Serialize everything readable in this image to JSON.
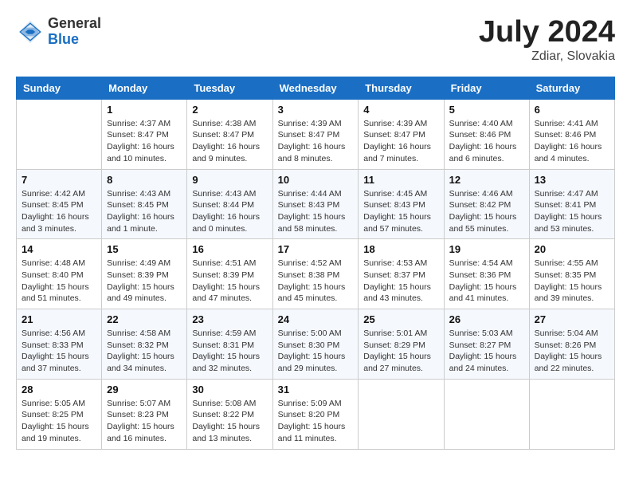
{
  "header": {
    "logo_line1": "General",
    "logo_line2": "Blue",
    "month": "July 2024",
    "location": "Zdiar, Slovakia"
  },
  "weekdays": [
    "Sunday",
    "Monday",
    "Tuesday",
    "Wednesday",
    "Thursday",
    "Friday",
    "Saturday"
  ],
  "weeks": [
    [
      {
        "day": "",
        "info": ""
      },
      {
        "day": "1",
        "info": "Sunrise: 4:37 AM\nSunset: 8:47 PM\nDaylight: 16 hours\nand 10 minutes."
      },
      {
        "day": "2",
        "info": "Sunrise: 4:38 AM\nSunset: 8:47 PM\nDaylight: 16 hours\nand 9 minutes."
      },
      {
        "day": "3",
        "info": "Sunrise: 4:39 AM\nSunset: 8:47 PM\nDaylight: 16 hours\nand 8 minutes."
      },
      {
        "day": "4",
        "info": "Sunrise: 4:39 AM\nSunset: 8:47 PM\nDaylight: 16 hours\nand 7 minutes."
      },
      {
        "day": "5",
        "info": "Sunrise: 4:40 AM\nSunset: 8:46 PM\nDaylight: 16 hours\nand 6 minutes."
      },
      {
        "day": "6",
        "info": "Sunrise: 4:41 AM\nSunset: 8:46 PM\nDaylight: 16 hours\nand 4 minutes."
      }
    ],
    [
      {
        "day": "7",
        "info": "Sunrise: 4:42 AM\nSunset: 8:45 PM\nDaylight: 16 hours\nand 3 minutes."
      },
      {
        "day": "8",
        "info": "Sunrise: 4:43 AM\nSunset: 8:45 PM\nDaylight: 16 hours\nand 1 minute."
      },
      {
        "day": "9",
        "info": "Sunrise: 4:43 AM\nSunset: 8:44 PM\nDaylight: 16 hours\nand 0 minutes."
      },
      {
        "day": "10",
        "info": "Sunrise: 4:44 AM\nSunset: 8:43 PM\nDaylight: 15 hours\nand 58 minutes."
      },
      {
        "day": "11",
        "info": "Sunrise: 4:45 AM\nSunset: 8:43 PM\nDaylight: 15 hours\nand 57 minutes."
      },
      {
        "day": "12",
        "info": "Sunrise: 4:46 AM\nSunset: 8:42 PM\nDaylight: 15 hours\nand 55 minutes."
      },
      {
        "day": "13",
        "info": "Sunrise: 4:47 AM\nSunset: 8:41 PM\nDaylight: 15 hours\nand 53 minutes."
      }
    ],
    [
      {
        "day": "14",
        "info": "Sunrise: 4:48 AM\nSunset: 8:40 PM\nDaylight: 15 hours\nand 51 minutes."
      },
      {
        "day": "15",
        "info": "Sunrise: 4:49 AM\nSunset: 8:39 PM\nDaylight: 15 hours\nand 49 minutes."
      },
      {
        "day": "16",
        "info": "Sunrise: 4:51 AM\nSunset: 8:39 PM\nDaylight: 15 hours\nand 47 minutes."
      },
      {
        "day": "17",
        "info": "Sunrise: 4:52 AM\nSunset: 8:38 PM\nDaylight: 15 hours\nand 45 minutes."
      },
      {
        "day": "18",
        "info": "Sunrise: 4:53 AM\nSunset: 8:37 PM\nDaylight: 15 hours\nand 43 minutes."
      },
      {
        "day": "19",
        "info": "Sunrise: 4:54 AM\nSunset: 8:36 PM\nDaylight: 15 hours\nand 41 minutes."
      },
      {
        "day": "20",
        "info": "Sunrise: 4:55 AM\nSunset: 8:35 PM\nDaylight: 15 hours\nand 39 minutes."
      }
    ],
    [
      {
        "day": "21",
        "info": "Sunrise: 4:56 AM\nSunset: 8:33 PM\nDaylight: 15 hours\nand 37 minutes."
      },
      {
        "day": "22",
        "info": "Sunrise: 4:58 AM\nSunset: 8:32 PM\nDaylight: 15 hours\nand 34 minutes."
      },
      {
        "day": "23",
        "info": "Sunrise: 4:59 AM\nSunset: 8:31 PM\nDaylight: 15 hours\nand 32 minutes."
      },
      {
        "day": "24",
        "info": "Sunrise: 5:00 AM\nSunset: 8:30 PM\nDaylight: 15 hours\nand 29 minutes."
      },
      {
        "day": "25",
        "info": "Sunrise: 5:01 AM\nSunset: 8:29 PM\nDaylight: 15 hours\nand 27 minutes."
      },
      {
        "day": "26",
        "info": "Sunrise: 5:03 AM\nSunset: 8:27 PM\nDaylight: 15 hours\nand 24 minutes."
      },
      {
        "day": "27",
        "info": "Sunrise: 5:04 AM\nSunset: 8:26 PM\nDaylight: 15 hours\nand 22 minutes."
      }
    ],
    [
      {
        "day": "28",
        "info": "Sunrise: 5:05 AM\nSunset: 8:25 PM\nDaylight: 15 hours\nand 19 minutes."
      },
      {
        "day": "29",
        "info": "Sunrise: 5:07 AM\nSunset: 8:23 PM\nDaylight: 15 hours\nand 16 minutes."
      },
      {
        "day": "30",
        "info": "Sunrise: 5:08 AM\nSunset: 8:22 PM\nDaylight: 15 hours\nand 13 minutes."
      },
      {
        "day": "31",
        "info": "Sunrise: 5:09 AM\nSunset: 8:20 PM\nDaylight: 15 hours\nand 11 minutes."
      },
      {
        "day": "",
        "info": ""
      },
      {
        "day": "",
        "info": ""
      },
      {
        "day": "",
        "info": ""
      }
    ]
  ]
}
